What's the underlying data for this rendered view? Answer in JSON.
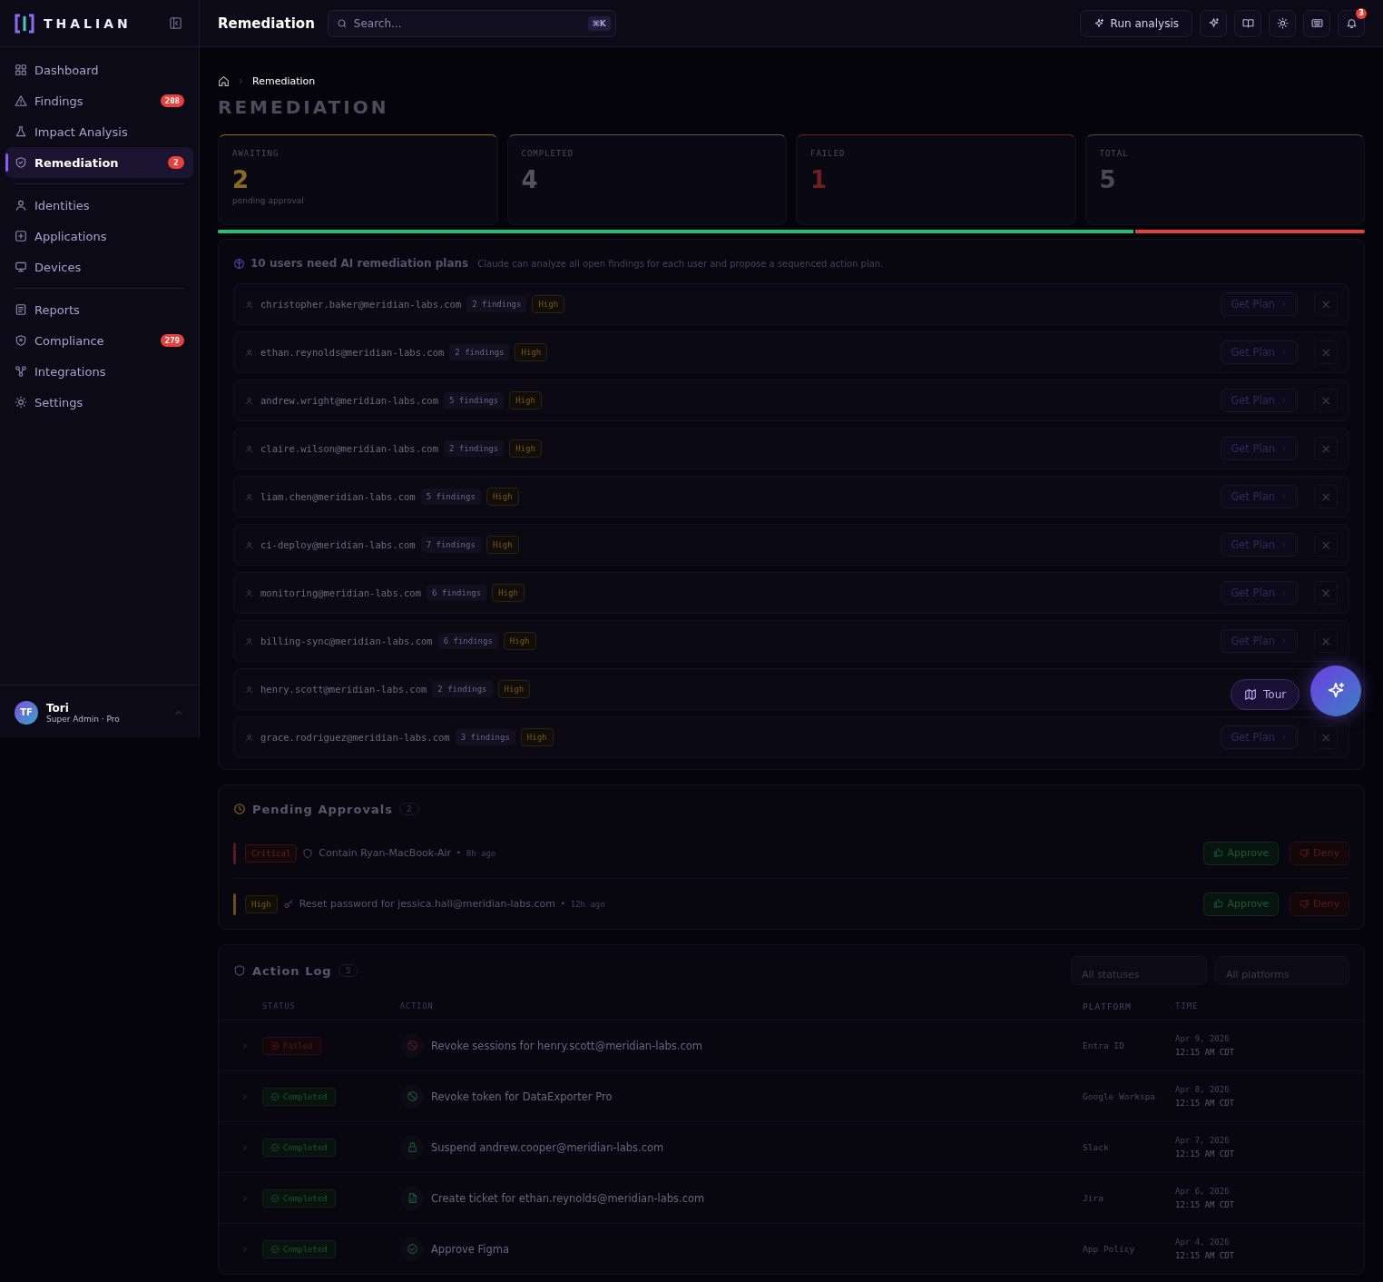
{
  "brand": {
    "name": "THALIAN"
  },
  "sidebar": {
    "groups": [
      [
        {
          "label": "Dashboard",
          "selected": false
        },
        {
          "label": "Findings",
          "selected": false,
          "badge": "208"
        },
        {
          "label": "Impact Analysis",
          "selected": false
        },
        {
          "label": "Remediation",
          "selected": true,
          "badge": "2"
        }
      ],
      [
        {
          "label": "Identities",
          "selected": false
        },
        {
          "label": "Applications",
          "selected": false
        },
        {
          "label": "Devices",
          "selected": false
        }
      ],
      [
        {
          "label": "Reports",
          "selected": false
        },
        {
          "label": "Compliance",
          "selected": false,
          "badge": "279"
        },
        {
          "label": "Integrations",
          "selected": false
        },
        {
          "label": "Settings",
          "selected": false
        }
      ]
    ],
    "user": {
      "initials": "TF",
      "name": "Tori",
      "role": "Super Admin · Pro"
    }
  },
  "header": {
    "title": "Remediation",
    "search": {
      "placeholder": "Search...",
      "shortcut": "⌘K"
    },
    "run_button": "Run analysis",
    "notifications": "3"
  },
  "breadcrumb": [
    "Remediation"
  ],
  "page_title": "REMEDIATION",
  "stats": [
    {
      "label": "AWAITING",
      "value": "2",
      "note": "pending approval",
      "color": "#8a6a1e"
    },
    {
      "label": "COMPLETED",
      "value": "4",
      "color": "#55525f"
    },
    {
      "label": "FAILED",
      "value": "1",
      "color": "#6e1f22"
    },
    {
      "label": "TOTAL",
      "value": "5",
      "color": "#4a4756"
    }
  ],
  "progress": {
    "level": 0.8
  },
  "ai_plans": {
    "title": "10 users need AI remediation plans",
    "subtitle": "Claude can analyze all open findings for each user and propose a sequenced action plan.",
    "users": [
      {
        "email": "christopher.baker@meridian-labs.com",
        "findings": "2 findings",
        "severity": "High",
        "button": "Get Plan",
        "close": "×"
      },
      {
        "email": "ethan.reynolds@meridian-labs.com",
        "findings": "2 findings",
        "severity": "High",
        "button": "Get Plan",
        "close": "×"
      },
      {
        "email": "andrew.wright@meridian-labs.com",
        "findings": "5 findings",
        "severity": "High",
        "button": "Get Plan",
        "close": "×"
      },
      {
        "email": "claire.wilson@meridian-labs.com",
        "findings": "2 findings",
        "severity": "High",
        "button": "Get Plan",
        "close": "×"
      },
      {
        "email": "liam.chen@meridian-labs.com",
        "findings": "5 findings",
        "severity": "High",
        "button": "Get Plan",
        "close": "×"
      },
      {
        "email": "ci-deploy@meridian-labs.com",
        "findings": "7 findings",
        "severity": "High",
        "button": "Get Plan",
        "close": "×"
      },
      {
        "email": "monitoring@meridian-labs.com",
        "findings": "6 findings",
        "severity": "High",
        "button": "Get Plan",
        "close": "×"
      },
      {
        "email": "billing-sync@meridian-labs.com",
        "findings": "6 findings",
        "severity": "High",
        "button": "Get Plan",
        "close": "×"
      },
      {
        "email": "henry.scott@meridian-labs.com",
        "findings": "2 findings",
        "severity": "High"
      },
      {
        "email": "grace.rodriguez@meridian-labs.com",
        "findings": "3 findings",
        "severity": "High",
        "button": "Get Plan",
        "close": "×"
      }
    ]
  },
  "pending": {
    "title": "Pending Approvals",
    "count": "2",
    "items": [
      {
        "kind": "critical",
        "severity": "Critical",
        "text": "Contain Ryan-MacBook-Air",
        "separator": "•",
        "age": "8h ago",
        "approve": "Approve",
        "deny": "Deny"
      },
      {
        "kind": "high",
        "severity": "High",
        "text": "Reset password for jessica.hall@meridian-labs.com",
        "separator": "•",
        "age": "12h ago",
        "approve": "Approve",
        "deny": "Deny"
      }
    ]
  },
  "action_log": {
    "title": "Action Log",
    "count": "5",
    "filters": [
      "All statuses",
      "All platforms"
    ],
    "columns": [
      "STATUS",
      "ACTION",
      "PLATFORM",
      "TIME"
    ],
    "rows": [
      {
        "kind": "failed",
        "status": "Failed",
        "action": "Revoke sessions for henry.scott@meridian-labs.com",
        "platform": "Entra ID",
        "date": "Apr 9, 2026",
        "time": "12:15 AM CDT"
      },
      {
        "kind": "completed",
        "status": "Completed",
        "action": "Revoke token for DataExporter Pro",
        "platform": "Google Workspa",
        "date": "Apr 8, 2026",
        "time": "12:15 AM CDT"
      },
      {
        "kind": "completed",
        "status": "Completed",
        "action": "Suspend andrew.cooper@meridian-labs.com",
        "platform": "Slack",
        "date": "Apr 7, 2026",
        "time": "12:15 AM CDT"
      },
      {
        "kind": "completed",
        "status": "Completed",
        "action": "Create ticket for ethan.reynolds@meridian-labs.com",
        "platform": "Jira",
        "date": "Apr 6, 2026",
        "time": "12:15 AM CDT"
      },
      {
        "kind": "completed",
        "status": "Completed",
        "action": "Approve Figma",
        "platform": "App Policy",
        "date": "Apr 4, 2026",
        "time": "12:15 AM CDT"
      }
    ]
  },
  "tour_button": "Tour"
}
